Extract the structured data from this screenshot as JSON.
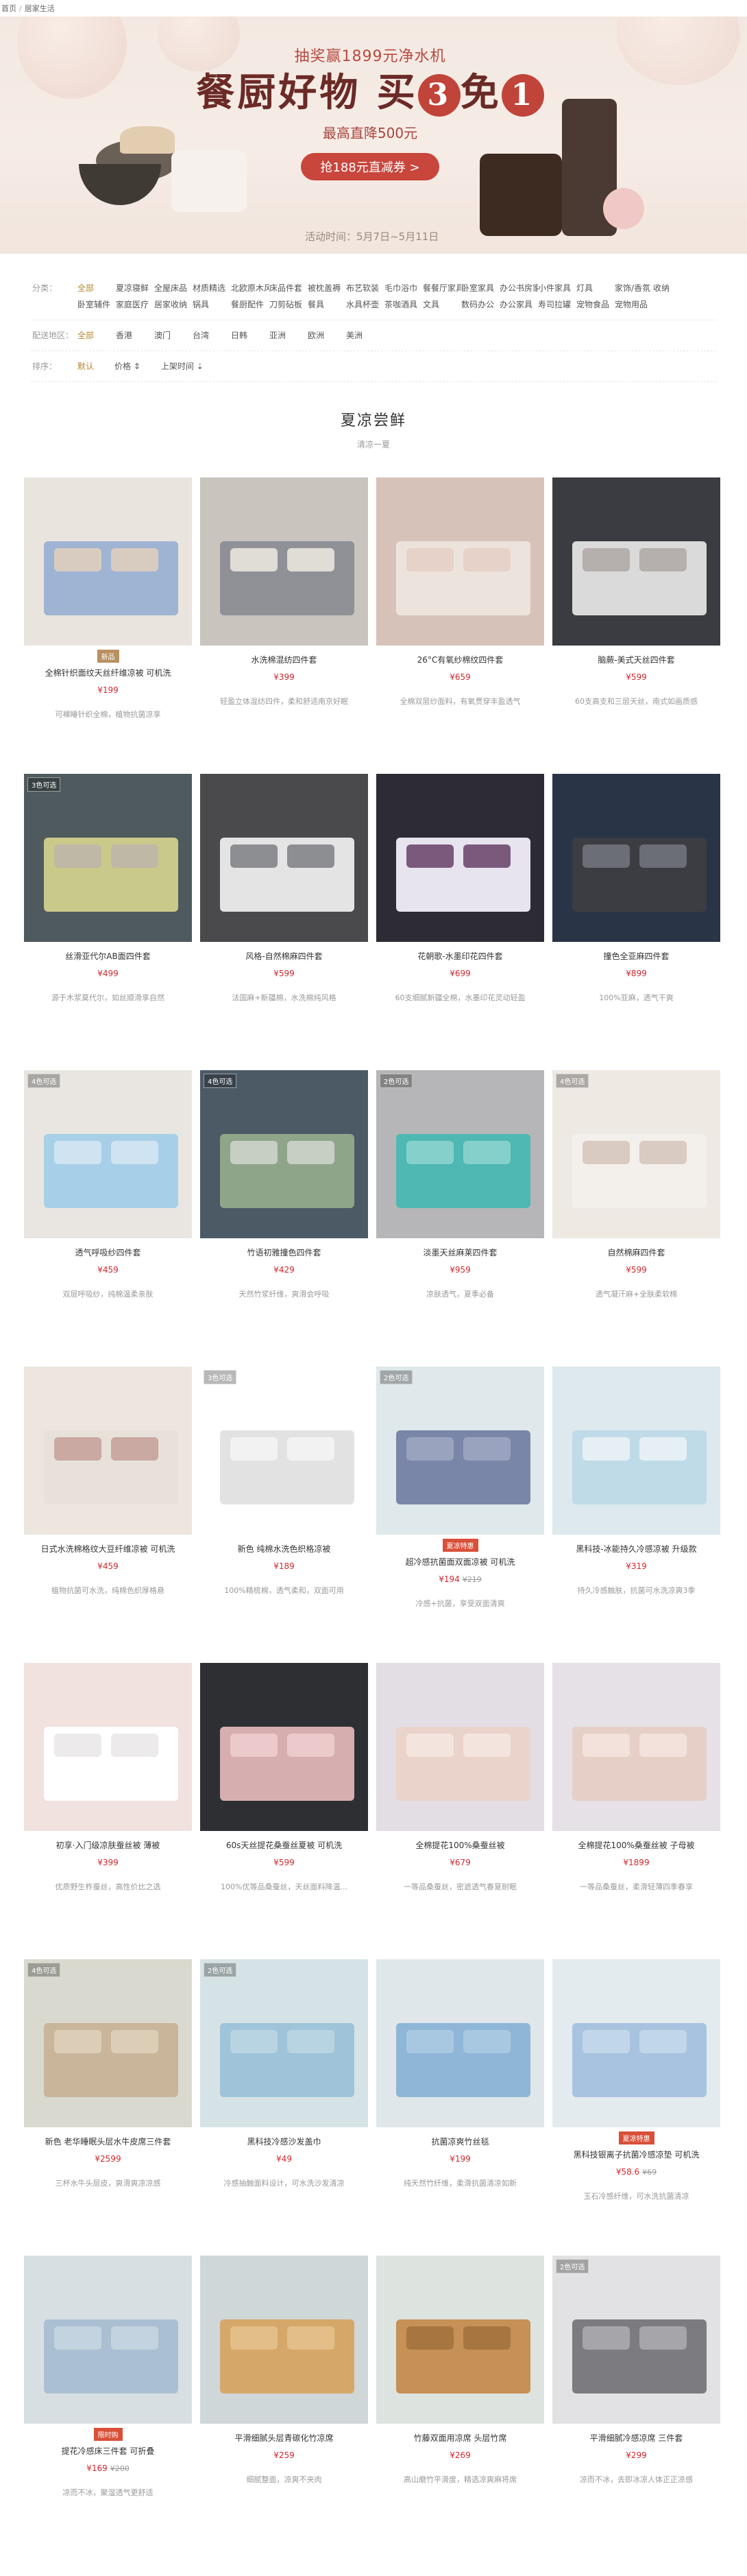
{
  "breadcrumb": {
    "home": "首页",
    "current": "居家生活"
  },
  "banner": {
    "top": "抽奖赢1899元净水机",
    "main_a": "餐厨好物 买",
    "main_num": "3",
    "main_b": "免",
    "main_num2": "1",
    "sub": "最高直降500元",
    "button": "抢188元直减券 >",
    "time": "活动时间：5月7日~5月11日"
  },
  "filters": {
    "category_label": "分类：",
    "categories": [
      "全部",
      "夏凉寝鲜",
      "全屋床品",
      "材质精选",
      "北欧原木风",
      "床品件套",
      "被枕盖褥",
      "布艺软装",
      "毛巾浴巾",
      "餐餐厅家具",
      "卧室家具",
      "办公书房家具",
      "小件家具",
      "灯具",
      "家饰/香氛",
      "收纳",
      "卧室辅件",
      "家庭医疗",
      "居家收纳",
      "锅具",
      "餐厨配件",
      "刀剪砧板",
      "餐具",
      "水具杯壶",
      "茶咖酒具",
      "文具",
      "数码办公",
      "办公家具",
      "寿司拉罐",
      "宠物食品",
      "宠物用品"
    ],
    "region_label": "配送地区：",
    "regions": [
      "全部",
      "香港",
      "澳门",
      "台湾",
      "日韩",
      "亚洲",
      "欧洲",
      "美洲"
    ],
    "sort_label": "排序：",
    "sorts": [
      "默认",
      "价格 ⇕",
      "上架时间 ⇣"
    ]
  },
  "section": {
    "title": "夏凉尝鲜",
    "subtitle": "清凉一夏"
  },
  "products": [
    {
      "name": "全棉针织面纹天丝纤维凉被 可机洗",
      "price": "¥199",
      "old": "",
      "desc": "可裸睡针织全棉，植物抗菌凉享",
      "tag": "",
      "badge": "新品",
      "img": [
        "#e9e4de",
        "#9fb3d3",
        "#d8ccc0"
      ]
    },
    {
      "name": "水洗棉混纺四件套",
      "price": "¥399",
      "old": "",
      "desc": "轻盈立体混纺四件，柔和舒适南京好眠",
      "tag": "",
      "badge": "",
      "img": [
        "#c9c4be",
        "#8f9197",
        "#e0dcd6"
      ]
    },
    {
      "name": "26°C有氧纱棉纹四件套",
      "price": "¥659",
      "old": "",
      "desc": "全棉双层纱面料，有氧贯穿丰盈透气",
      "tag": "",
      "badge": "",
      "img": [
        "#d6c2b8",
        "#ece3dd",
        "#e6d2c8"
      ]
    },
    {
      "name": "脑蕨-美式天丝四件套",
      "price": "¥599",
      "old": "",
      "desc": "60支高支和三层天丝，南式如画质感",
      "tag": "",
      "badge": "",
      "img": [
        "#3a3c41",
        "#dadadb",
        "#b5b0ad"
      ]
    },
    {
      "name": "丝滑亚代尔AB面四件套",
      "price": "¥499",
      "old": "",
      "desc": "源于木浆莫代尔，如丝顺滑享自然",
      "tag": "3色可选",
      "badge": "",
      "img": [
        "#4e5a5e",
        "#c9c98a",
        "#c0b8a6"
      ]
    },
    {
      "name": "风格-自然棉麻四件套",
      "price": "¥599",
      "old": "",
      "desc": "法国麻+新疆棉，水洗棉纯风格",
      "tag": "",
      "badge": "",
      "img": [
        "#4a4a4c",
        "#e4e4e4",
        "#8d8e92"
      ]
    },
    {
      "name": "花朝歌-水墨印花四件套",
      "price": "¥699",
      "old": "",
      "desc": "60支细腻新疆全棉，水墨印花灵动轻盈",
      "tag": "",
      "badge": "",
      "img": [
        "#2d2b34",
        "#e8e4ee",
        "#7a5a7c"
      ]
    },
    {
      "name": "撞色全亚麻四件套",
      "price": "¥899",
      "old": "",
      "desc": "100%亚麻，透气干爽",
      "tag": "",
      "badge": "",
      "img": [
        "#2a3447",
        "#3b3d43",
        "#6b6e76"
      ]
    },
    {
      "name": "透气呼吸纱四件套",
      "price": "¥459",
      "old": "",
      "desc": "双层呼吸纱，纯棉温柔亲肤",
      "tag": "4色可选",
      "badge": "",
      "img": [
        "#e9e6e2",
        "#a8cfe8",
        "#cfe3f0"
      ]
    },
    {
      "name": "竹语初雅撞色四件套",
      "price": "¥429",
      "old": "",
      "desc": "天然竹浆纤维，爽滑会呼吸",
      "tag": "4色可选",
      "badge": "",
      "img": [
        "#4c5a66",
        "#8fa58a",
        "#c7cfc4"
      ]
    },
    {
      "name": "淡墨天丝麻莱四件套",
      "price": "¥959",
      "old": "",
      "desc": "凉肤透气，夏季必备",
      "tag": "2色可选",
      "badge": "",
      "img": [
        "#b6b6b8",
        "#4fb8b2",
        "#86d0cb"
      ]
    },
    {
      "name": "自然棉麻四件套",
      "price": "¥599",
      "old": "",
      "desc": "透气凝汗麻+全肤柔软棉",
      "tag": "4色可选",
      "badge": "",
      "img": [
        "#efe9e4",
        "#f3efea",
        "#d9cbc2"
      ]
    },
    {
      "name": "日式水洗棉格纹大豆纤维凉被 可机洗",
      "price": "¥459",
      "old": "",
      "desc": "植物抗菌可水洗，纯棉色织厚格悬",
      "tag": "",
      "badge": "",
      "img": [
        "#ece6df",
        "#e7e1da",
        "#c9a9a2"
      ]
    },
    {
      "name": "新色 纯棉水洗色织格凉被",
      "price": "¥189",
      "old": "",
      "desc": "100%精梳棉，透气柔和，双面可用",
      "tag": "3色可选",
      "badge": "",
      "img": [
        "#ffffff",
        "#e2e2e2",
        "#f2f2f2"
      ]
    },
    {
      "name": "超冷感抗菌面双面凉被 可机洗",
      "price": "¥194",
      "old": "¥219",
      "desc": "冷感+抗菌，享受双面清爽",
      "tag": "2色可选",
      "badge": "夏凉特惠",
      "img": [
        "#dfe8ea",
        "#7a86a8",
        "#9aa3be"
      ]
    },
    {
      "name": "黑科技-冰能持久冷感凉被 升级款",
      "price": "¥319",
      "old": "",
      "desc": "持久冷感触肤，抗菌可水洗凉爽3季",
      "tag": "",
      "badge": "",
      "img": [
        "#dde9ec",
        "#bfdbe8",
        "#e6f0f4"
      ]
    },
    {
      "name": "初享·入门级凉肤蚕丝被 薄被",
      "price": "¥399",
      "old": "",
      "desc": "优质野生柞蚕丝，高性价比之选",
      "tag": "",
      "badge": "",
      "img": [
        "#f1e1df",
        "#ffffff",
        "#eceaea"
      ]
    },
    {
      "name": "60s天丝提花桑蚕丝夏被 可机洗",
      "price": "¥599",
      "old": "",
      "desc": "100%优等品桑蚕丝，天丝面料降温...",
      "tag": "",
      "badge": "",
      "img": [
        "#2d2f33",
        "#d7aeb0",
        "#ecc9ca"
      ]
    },
    {
      "name": "全棉提花100%桑蚕丝被",
      "price": "¥679",
      "old": "",
      "desc": "一等品桑蚕丝，密遮透气春夏耐眠",
      "tag": "",
      "badge": "",
      "img": [
        "#e3dde4",
        "#ead3cb",
        "#f3e4de"
      ]
    },
    {
      "name": "全棉提花100%桑蚕丝被 子母被",
      "price": "¥1899",
      "old": "",
      "desc": "一等品桑蚕丝，柔滑轻薄四季春享",
      "tag": "",
      "badge": "",
      "img": [
        "#e5e1e6",
        "#e6cfc7",
        "#f2e2db"
      ]
    },
    {
      "name": "新色 老华睡眠头层水牛皮席三件套",
      "price": "¥2599",
      "old": "",
      "desc": "三杯水牛头层皮，爽滑爽凉凉感",
      "tag": "4色可选",
      "badge": "",
      "img": [
        "#d9d9cf",
        "#c9b59a",
        "#dccdb7"
      ]
    },
    {
      "name": "黑科技冷感沙发盖巾",
      "price": "¥49",
      "old": "",
      "desc": "冷感抽触面料设计，可水洗沙发清凉",
      "tag": "2色可选",
      "badge": "",
      "img": [
        "#d6e3e6",
        "#9fc3d8",
        "#b8d3e2"
      ]
    },
    {
      "name": "抗菌凉爽竹丝毯",
      "price": "¥199",
      "old": "",
      "desc": "纯天然竹纤维，柔滑抗菌清凉如新",
      "tag": "",
      "badge": "",
      "img": [
        "#dfe7ea",
        "#8fb6d6",
        "#a8c8e2"
      ]
    },
    {
      "name": "黑科技银离子抗菌冷感凉垫 可机洗",
      "price": "¥58.6",
      "old": "¥69",
      "desc": "玉石冷感纤维，可水洗抗菌清凉",
      "tag": "",
      "badge": "夏凉特惠",
      "img": [
        "#e4ebef",
        "#a7c3df",
        "#c2d6ea"
      ]
    },
    {
      "name": "提花冷感床三件套 可折叠",
      "price": "¥169",
      "old": "¥200",
      "desc": "凉而不冰，聚湿透气更舒适",
      "tag": "",
      "badge": "限时购",
      "img": [
        "#d8dfe3",
        "#aac0d2",
        "#c3d3df"
      ]
    },
    {
      "name": "平滑细腻头层青碳化竹凉席",
      "price": "¥259",
      "old": "",
      "desc": "细腻整面，凉爽不夹肉",
      "tag": "",
      "badge": "",
      "img": [
        "#cfd7d8",
        "#d5a86a",
        "#e3be88"
      ]
    },
    {
      "name": "竹藤双面用凉席 头层竹席",
      "price": "¥269",
      "old": "",
      "desc": "高山磨竹平滑度，精选凉爽麻将席",
      "tag": "",
      "badge": "",
      "img": [
        "#dde3df",
        "#c59156",
        "#a77640"
      ]
    },
    {
      "name": "平滑细腻冷感凉席 三件套",
      "price": "¥299",
      "old": "",
      "desc": "凉而不冰，去即冰凉人体正正凉感",
      "tag": "2色可选",
      "badge": "",
      "img": [
        "#e2e2e4",
        "#7c7c80",
        "#a5a5aa"
      ]
    }
  ]
}
